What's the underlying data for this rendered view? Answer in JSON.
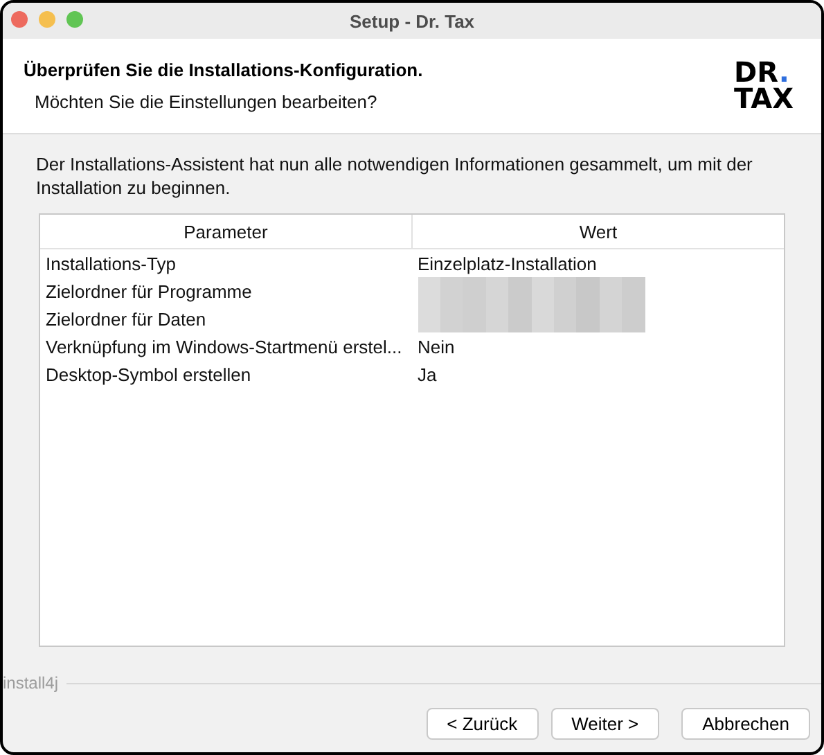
{
  "window": {
    "title": "Setup - Dr. Tax"
  },
  "header": {
    "title": "Überprüfen Sie die Installations-Konfiguration.",
    "subtitle": "Möchten Sie die Einstellungen bearbeiten?",
    "logo": {
      "line_1": "DR",
      "dot": ".",
      "line_2": "TAX"
    }
  },
  "intro": "Der Installations-Assistent hat nun alle notwendigen Informationen gesammelt, um mit der Installation zu beginnen.",
  "table": {
    "columns": [
      "Parameter",
      "Wert"
    ],
    "rows": [
      {
        "kind": "text",
        "parameter": "Installations-Typ",
        "value": "Einzelplatz-Installation"
      },
      {
        "kind": "redacted",
        "parameter": "Zielordner für Programme"
      },
      {
        "kind": "redacted",
        "parameter": "Zielordner für Daten"
      },
      {
        "kind": "text",
        "parameter": "Verknüpfung im Windows-Startmenü erstel...",
        "value": "Nein"
      },
      {
        "kind": "text",
        "parameter": "Desktop-Symbol erstellen",
        "value": "Ja"
      }
    ]
  },
  "footer": {
    "brand": "install4j"
  },
  "buttons": [
    "< Zurück",
    "Weiter >",
    "Abbrechen"
  ]
}
